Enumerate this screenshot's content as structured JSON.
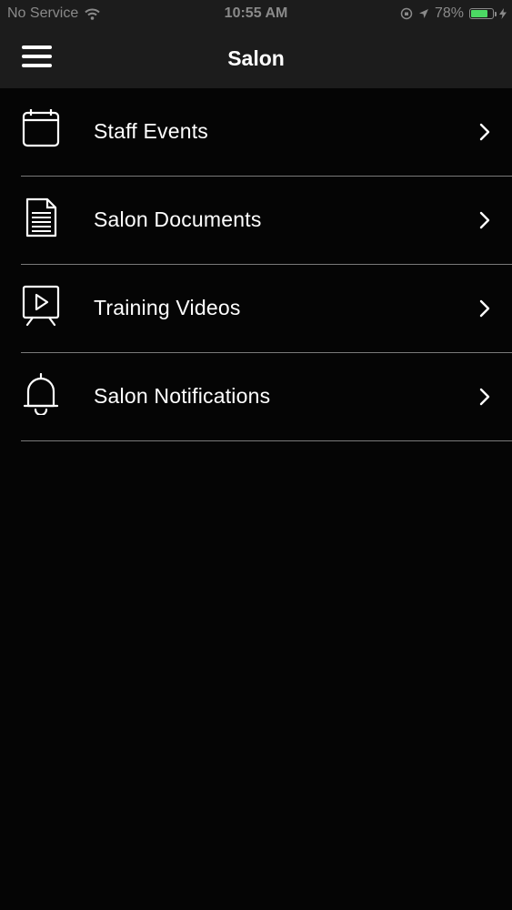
{
  "status_bar": {
    "carrier": "No Service",
    "time": "10:55 AM",
    "battery": "78%",
    "battery_level": 0.78,
    "battery_color": "#4cd964",
    "icons": [
      "wifi-icon",
      "orientation-lock-icon",
      "location-icon",
      "charging-icon"
    ]
  },
  "nav": {
    "title": "Salon",
    "menu_icon": "hamburger-menu-icon"
  },
  "menu": {
    "items": [
      {
        "label": "Staff Events",
        "icon": "calendar-icon"
      },
      {
        "label": "Salon Documents",
        "icon": "document-icon"
      },
      {
        "label": "Training Videos",
        "icon": "video-presentation-icon"
      },
      {
        "label": "Salon Notifications",
        "icon": "bell-icon"
      }
    ],
    "accessory_icon": "chevron-right-icon"
  },
  "colors": {
    "background": "#050505",
    "nav_background": "#1c1c1c",
    "divider": "#7a7a7a",
    "text": "#ffffff"
  }
}
